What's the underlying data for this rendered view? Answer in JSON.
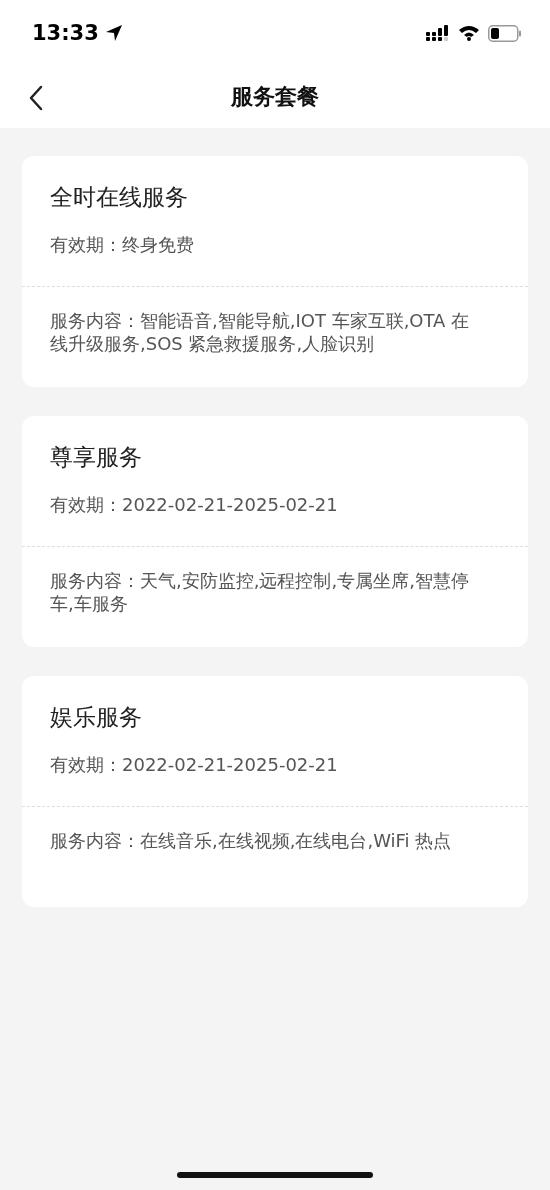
{
  "status_bar": {
    "time": "13:33"
  },
  "nav": {
    "title": "服务套餐"
  },
  "packages": [
    {
      "name": "全时在线服务",
      "validity": "有效期：终身免费",
      "content": "服务内容：智能语音,智能导航,IOT 车家互联,OTA 在线升级服务,SOS 紧急救援服务,人脸识别"
    },
    {
      "name": "尊享服务",
      "validity": "有效期：2022-02-21-2025-02-21",
      "content": "服务内容：天气,安防监控,远程控制,专属坐席,智慧停车,车服务"
    },
    {
      "name": "娱乐服务",
      "validity": "有效期：2022-02-21-2025-02-21",
      "content": "服务内容：在线音乐,在线视频,在线电台,WiFi 热点"
    }
  ]
}
